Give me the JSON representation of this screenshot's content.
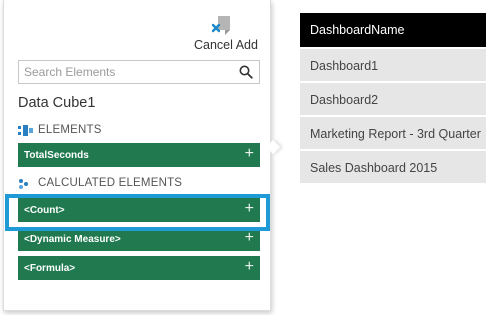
{
  "panel": {
    "cancel_add_label": "Cancel Add",
    "search_placeholder": "Search Elements",
    "cube_title": "Data Cube1",
    "elements_header": "ELEMENTS",
    "elements": [
      {
        "label": "TotalSeconds",
        "action_icon": "+"
      }
    ],
    "calculated_header": "CALCULATED ELEMENTS",
    "calculated": [
      {
        "label": "<Count>",
        "action_icon": "+"
      },
      {
        "label": "<Dynamic Measure>",
        "action_icon": "+"
      },
      {
        "label": "<Formula>",
        "action_icon": "+"
      }
    ],
    "row_color": "#217a4f",
    "highlight_color": "#1e9bd7"
  },
  "list": {
    "header": "DashboardName",
    "items": [
      "Dashboard1",
      "Dashboard2",
      "Marketing Report - 3rd Quarter",
      "Sales Dashboard 2015"
    ]
  }
}
